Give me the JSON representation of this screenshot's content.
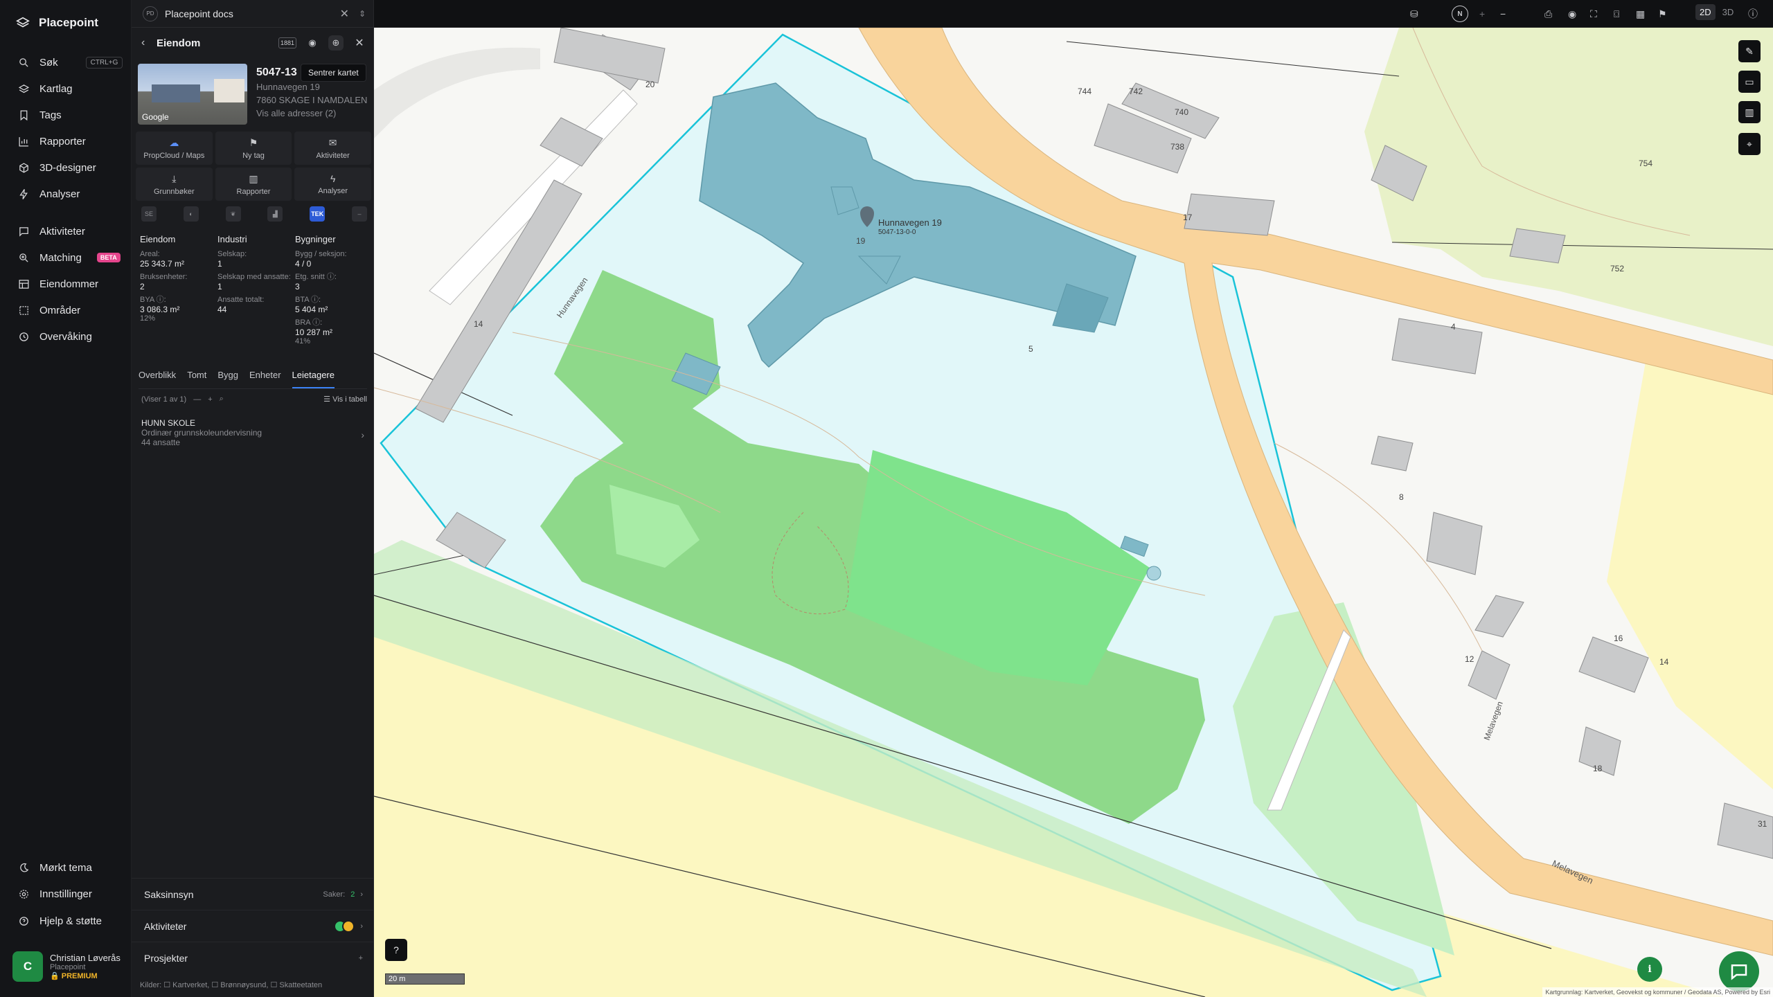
{
  "app": {
    "name": "Placepoint"
  },
  "nav": {
    "items": [
      {
        "label": "Søk",
        "icon": "search-icon",
        "shortcut": "CTRL+G"
      },
      {
        "label": "Kartlag",
        "icon": "layers-icon"
      },
      {
        "label": "Tags",
        "icon": "bookmark-icon"
      },
      {
        "label": "Rapporter",
        "icon": "chart-icon"
      },
      {
        "label": "3D-designer",
        "icon": "cube-icon"
      },
      {
        "label": "Analyser",
        "icon": "bolt-icon"
      },
      {
        "label": "Aktiviteter",
        "icon": "message-icon"
      },
      {
        "label": "Matching",
        "icon": "search-plus-icon",
        "badge": "BETA"
      },
      {
        "label": "Eiendommer",
        "icon": "table-icon"
      },
      {
        "label": "Områder",
        "icon": "area-icon"
      },
      {
        "label": "Overvåking",
        "icon": "monitor-icon"
      }
    ],
    "bottom": [
      {
        "label": "Mørkt tema",
        "icon": "moon-icon"
      },
      {
        "label": "Innstillinger",
        "icon": "gear-icon"
      },
      {
        "label": "Hjelp & støtte",
        "icon": "help-icon"
      }
    ],
    "user": {
      "initial": "C",
      "name": "Christian Løverås",
      "org": "Placepoint",
      "plan": "PREMIUM"
    }
  },
  "panel": {
    "tab_title": "Placepoint docs",
    "tab_badge": "PD",
    "header_title": "Eiendom",
    "header_badge": "1881",
    "tooltip": "Sentrer kartet",
    "photo_label": "Google",
    "property_id": "5047-13",
    "address": "Hunnavegen 19",
    "postal": "7860 SKAGE I NAMDALEN",
    "all_addresses": "Vis alle adresser (2)",
    "quick": [
      {
        "label": "PropCloud / Maps",
        "glyph": "☁"
      },
      {
        "label": "Ny tag",
        "glyph": "⚑"
      },
      {
        "label": "Aktiviteter",
        "glyph": "✉"
      },
      {
        "label": "Grunnbøker",
        "glyph": "⤓"
      },
      {
        "label": "Rapporter",
        "glyph": "▥"
      },
      {
        "label": "Analyser",
        "glyph": "ϟ"
      }
    ],
    "badges": [
      "SE",
      "◐",
      "❦",
      "▟",
      "TEK",
      "–"
    ],
    "stats": {
      "eiendom": {
        "title": "Eiendom",
        "areal_k": "Areal:",
        "areal_v": "25 343.7 m²",
        "bruk_k": "Bruksenheter:",
        "bruk_v": "2",
        "bya_k": "BYA ⓘ:",
        "bya_v": "3 086.3 m²",
        "bya_pct": "12%"
      },
      "industri": {
        "title": "Industri",
        "selskap_k": "Selskap:",
        "selskap_v": "1",
        "ansatte_k": "Selskap med ansatte:",
        "ansatte_v": "1",
        "totalt_k": "Ansatte totalt:",
        "totalt_v": "44"
      },
      "bygninger": {
        "title": "Bygninger",
        "bygg_k": "Bygg / seksjon:",
        "bygg_v": "4 / 0",
        "etg_k": "Etg. snitt ⓘ:",
        "etg_v": "3",
        "bta_k": "BTA ⓘ:",
        "bta_v": "5 404 m²",
        "bra_k": "BRA ⓘ:",
        "bra_v": "10 287 m²",
        "bra_pct": "41%"
      }
    },
    "subtabs": [
      "Overblikk",
      "Tomt",
      "Bygg",
      "Enheter",
      "Leietagere"
    ],
    "list_count": "(Viser 1 av 1)",
    "view_table": "Vis i tabell",
    "tenant": {
      "name": "HUNN SKOLE",
      "desc": "Ordinær grunnskoleundervisning",
      "employees": "44 ansatte"
    },
    "saksinnsyn": {
      "label": "Saksinnsyn",
      "cases_label": "Saker:",
      "cases": "2"
    },
    "aktiviteter": {
      "label": "Aktiviteter"
    },
    "prosjekter": {
      "label": "Prosjekter"
    },
    "sources": "Kilder: ☐ Kartverket, ☐ Brønnøysund, ☐ Skatteetaten"
  },
  "map": {
    "mode_2d": "2D",
    "mode_3d": "3D",
    "compass": "N",
    "address_label": "Hunnavegen 19",
    "address_sub": "5047-13-0-0",
    "scale": "20 m",
    "attribution": "Kartgrunnlag: Kartverket, Geovekst og kommuner / Geodata AS, Powered by Esri",
    "road_labels": [
      "Hunnavegen",
      "Melavegen",
      "Melavegen"
    ],
    "house_numbers": [
      "20",
      "14",
      "744",
      "742",
      "740",
      "738",
      "754",
      "752",
      "4",
      "8",
      "12",
      "16",
      "14",
      "18",
      "5",
      "19",
      "17",
      "31"
    ],
    "colors": {
      "property_fill": "#e1f7f9",
      "property_border": "#19c3d8",
      "green": "#8ed98a",
      "building": "#7fb8c7",
      "road": "#f9d49c",
      "farm": "#fcf7c1"
    }
  }
}
